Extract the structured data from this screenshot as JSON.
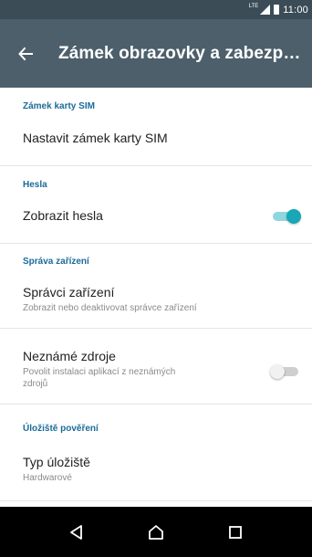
{
  "status_bar": {
    "network": "LTE",
    "time": "11:00"
  },
  "app_bar": {
    "title": "Zámek obrazovky a zabezp…"
  },
  "sections": {
    "sim": {
      "header": "Zámek karty SIM",
      "item_title": "Nastavit zámek karty SIM"
    },
    "passwords": {
      "header": "Hesla",
      "item_title": "Zobrazit hesla",
      "toggle_on": true
    },
    "device_admin": {
      "header": "Správa zařízení",
      "item_title": "Správci zařízení",
      "item_subtitle": "Zobrazit nebo deaktivovat správce zařízení",
      "unknown_title": "Neznámé zdroje",
      "unknown_subtitle_1": "Povolit instalaci aplikací z neznámých",
      "unknown_subtitle_2": "zdrojů",
      "unknown_toggle_on": false
    },
    "credential_storage": {
      "header": "Úložiště pověření",
      "item_title": "Typ úložiště",
      "item_subtitle": "Hardwarové"
    }
  },
  "colors": {
    "status_bar": "#3c4c57",
    "app_bar": "#4c5f6b",
    "section_header": "#1b6b98",
    "accent_toggle": "#17a7b6"
  },
  "icons": {
    "back": "arrow-left",
    "nav_back": "triangle-left",
    "nav_home": "house",
    "nav_recents": "square"
  }
}
